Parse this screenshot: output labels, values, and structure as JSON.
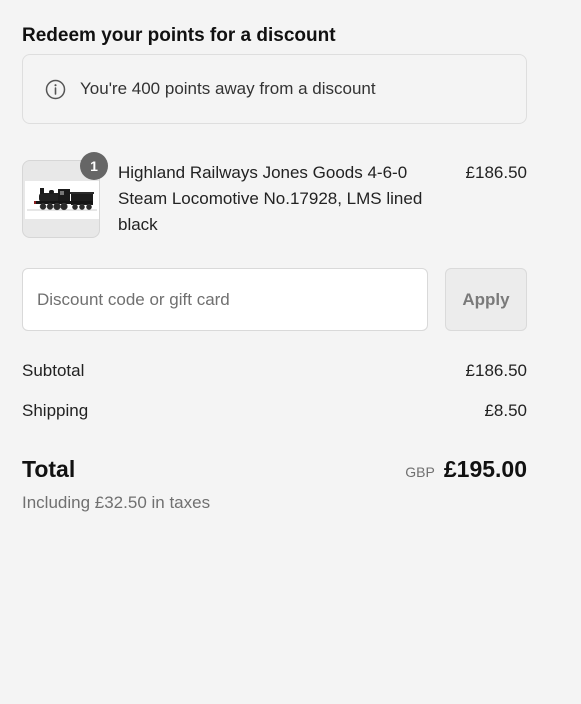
{
  "redeem": {
    "title": "Redeem your points for a discount",
    "message": "You're 400 points away from a discount",
    "icon": "info-icon"
  },
  "cart": {
    "items": [
      {
        "name": "Highland Railways Jones Goods 4-6-0 Steam Locomotive No.17928, LMS lined black",
        "price": "£186.50",
        "quantity": "1"
      }
    ]
  },
  "discount": {
    "placeholder": "Discount code or gift card",
    "value": "",
    "apply_label": "Apply"
  },
  "summary": {
    "subtotal_label": "Subtotal",
    "subtotal_value": "£186.50",
    "shipping_label": "Shipping",
    "shipping_value": "£8.50",
    "total_label": "Total",
    "currency": "GBP",
    "total_value": "£195.00",
    "tax_note": "Including £32.50 in taxes"
  },
  "colors": {
    "background": "#f4f4f4",
    "badge": "#666666",
    "button_bg": "#ececec"
  }
}
